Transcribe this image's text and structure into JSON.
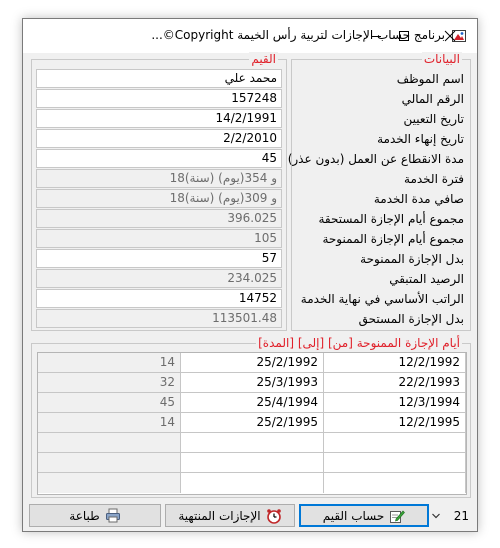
{
  "window": {
    "title": "برنامج حساب الإجازات لتربية رأس الخيمة Copyright©...",
    "controls": {
      "minimize": "minimize-icon",
      "maximize": "maximize-icon",
      "close": "close-icon"
    }
  },
  "labels_group": {
    "title": "البيانات",
    "items": [
      "اسم الموظف",
      "الرقم المالي",
      "تاريخ التعيين",
      "تاريخ إنهاء الخدمة",
      "مدة الانقطاع عن العمل (بدون عذر)",
      "فترة الخدمة",
      "صافي مدة الخدمة",
      "مجموع أيام الإجازة المستحقة",
      "مجموع أيام الإجازة الممنوحة",
      "بدل الإجازة الممنوحة",
      "الرصيد المتبقي",
      "الراتب الأساسي في نهاية الخدمة",
      "بدل الإجازة المستحق"
    ]
  },
  "values_group": {
    "title": "القيم",
    "items": [
      {
        "value": "محمد علي",
        "readonly": false
      },
      {
        "value": "157248",
        "readonly": false
      },
      {
        "value": "14/2/1991",
        "readonly": false
      },
      {
        "value": "2/2/2010",
        "readonly": false
      },
      {
        "value": "45",
        "readonly": false
      },
      {
        "value": "18(سنة) و 354(يوم)",
        "readonly": true
      },
      {
        "value": "18(سنة) و 309(يوم)",
        "readonly": true
      },
      {
        "value": "396.025",
        "readonly": true
      },
      {
        "value": "105",
        "readonly": true
      },
      {
        "value": "57",
        "readonly": false
      },
      {
        "value": "234.025",
        "readonly": true
      },
      {
        "value": "14752",
        "readonly": false
      },
      {
        "value": "113501.48",
        "readonly": true
      }
    ]
  },
  "leave_group": {
    "title": "أيام الإجازة الممنوحة [من] [إلى] [المدة]",
    "rows": [
      {
        "from": "12/2/1992",
        "to": "25/2/1992",
        "duration": "14"
      },
      {
        "from": "22/2/1993",
        "to": "25/3/1993",
        "duration": "32"
      },
      {
        "from": "12/3/1994",
        "to": "25/4/1994",
        "duration": "45"
      },
      {
        "from": "12/2/1995",
        "to": "25/2/1995",
        "duration": "14"
      },
      {
        "from": "",
        "to": "",
        "duration": ""
      },
      {
        "from": "",
        "to": "",
        "duration": ""
      },
      {
        "from": "",
        "to": "",
        "duration": ""
      }
    ]
  },
  "bottom_bar": {
    "counter_value": "21",
    "calculate_label": "حساب القيم",
    "expired_label": "الإجازات المنتهية",
    "print_label": "طباعة",
    "calculate_icon": "edit-pencil-icon",
    "expired_icon": "alarm-clock-icon",
    "print_icon": "printer-icon"
  },
  "colors": {
    "group_title": "#e0202a",
    "focus_border": "#0078d7",
    "window_bg": "#f0f0f0"
  }
}
